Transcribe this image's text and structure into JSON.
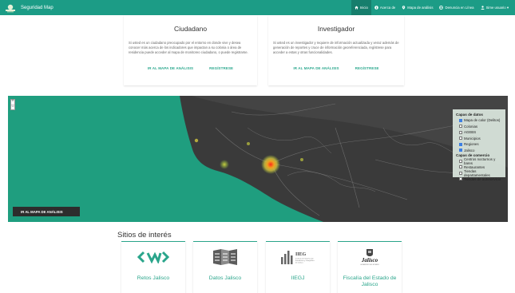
{
  "navbar": {
    "brand": "Seguridad Map",
    "items": [
      {
        "icon": "home-icon",
        "label": "Inicio",
        "active": true
      },
      {
        "icon": "info-icon",
        "label": "Acerca de",
        "active": false
      },
      {
        "icon": "map-pin-icon",
        "label": "Mapa de análisis",
        "active": false
      },
      {
        "icon": "globe-icon",
        "label": "Denuncia en Línea",
        "active": false
      },
      {
        "icon": "user-icon",
        "label": "Sime usuario ▾",
        "active": false
      }
    ]
  },
  "cards": {
    "citizen": {
      "title": "Ciudadano",
      "text": "Si usted es un ciudadano preocupado por el entorno en donde vive y desea conocer más acerca de los indicadores que impactan a su colonia o área de residencia puede acceder al mapa de monitoreo ciudadano, o puede registrarse.",
      "map_link": "IR AL MAPA DE ANÁLISIS",
      "register_link": "REGÍSTRESE"
    },
    "researcher": {
      "title": "Investigador",
      "text": "Si usted es un investigador y requiere de información actualizada y veraz además de generación de reportes y cruce de información georeferenciada, regístrese para acceder a estas y otras funcionalidades.",
      "map_link": "IR AL MAPA DE ANÁLISIS",
      "register_link": "REGÍSTRESE"
    }
  },
  "map": {
    "zoom_in": "+",
    "zoom_out": "−",
    "button": "IR AL MAPA DE ANÁLISIS",
    "data_layers_title": "Capas de datos",
    "data_layers": [
      {
        "label": "Mapa de calor (Delitos)",
        "checked": true
      },
      {
        "label": "Colonias",
        "checked": false
      },
      {
        "label": "AGEBS",
        "checked": false
      },
      {
        "label": "Municipios",
        "checked": false
      },
      {
        "label": "Regiones",
        "checked": true
      },
      {
        "label": "Jalisco",
        "checked": true
      }
    ],
    "commerce_layers_title": "Capas de comercio",
    "commerce_layers": [
      {
        "label": "Centros nocturnos y bares",
        "checked": false
      },
      {
        "label": "Restaurantes",
        "checked": false
      },
      {
        "label": "Tiendas departamentales",
        "checked": false
      },
      {
        "label": "Tiendas de autoservicio",
        "checked": false
      }
    ]
  },
  "sites": {
    "title": "Sitios de interés",
    "items": [
      {
        "label": "Retos Jalisco",
        "icon": "retos-jalisco-logo"
      },
      {
        "label": "Datos Jalisco",
        "icon": "datos-jalisco-logo"
      },
      {
        "label": "IIEGJ",
        "icon": "iiegj-logo",
        "logo_text": "IIEG",
        "logo_subtext": "Instituto de Información Estadística y Geográfica de Jalisco"
      },
      {
        "label": "Fiscalía del Estado de Jalisco",
        "icon": "jalisco-seal-logo",
        "logo_text": "Jalisco",
        "logo_subtext": "GOBIERNO DEL ESTADO"
      }
    ]
  },
  "colors": {
    "brand": "#1c9c86",
    "accent": "#2aa58b",
    "heat": "#e8322a"
  }
}
